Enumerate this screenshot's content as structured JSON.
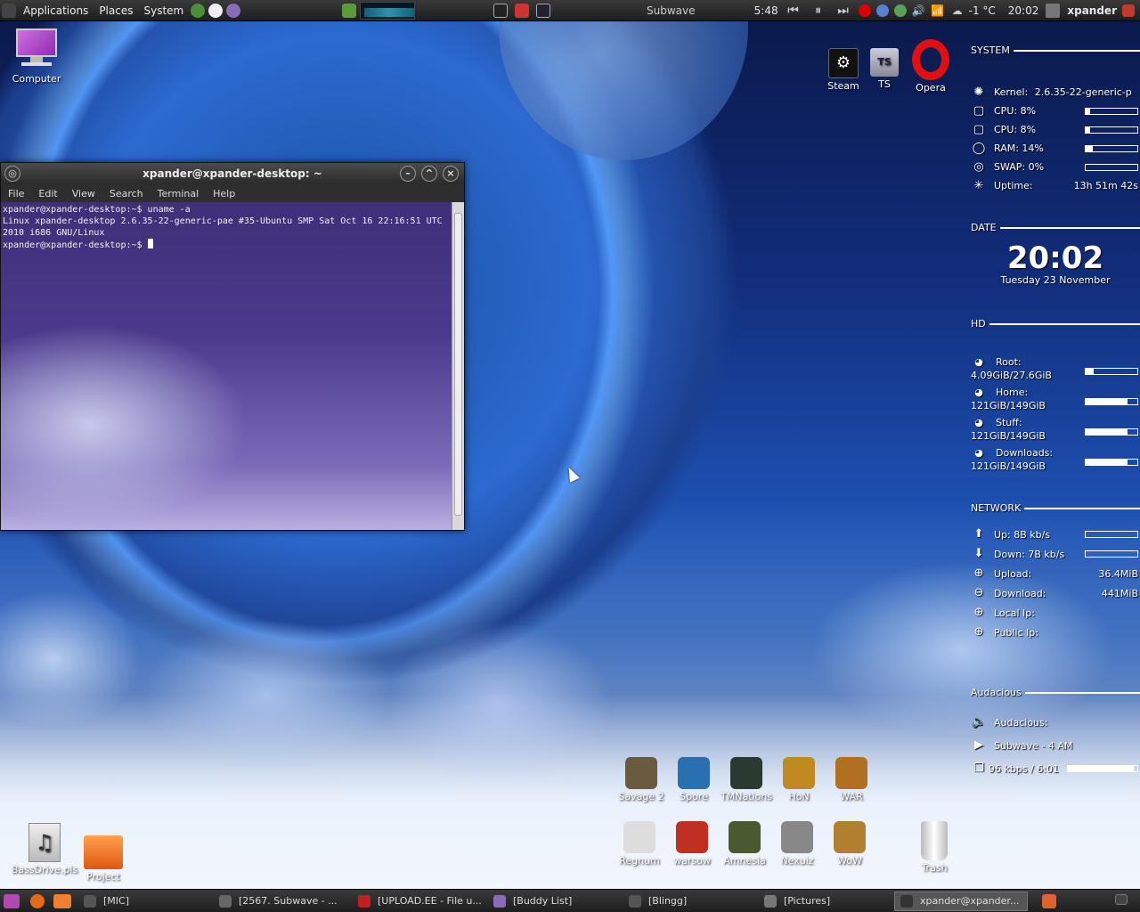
{
  "top_panel": {
    "menus": [
      "Applications",
      "Places",
      "System"
    ],
    "now_playing": "Subwave",
    "time_elapsed": "5:48",
    "weather": "-1 °C",
    "clock": "20:02",
    "user": "xpander"
  },
  "desktop_icons": {
    "computer": "Computer",
    "steam": "Steam",
    "ts": "TS",
    "ts_glyph": "TS",
    "opera": "Opera",
    "bassdrive": "BassDrive.pls",
    "project": "Project",
    "trash": "Trash"
  },
  "terminal": {
    "title": "xpander@xpander-desktop: ~",
    "menu": [
      "File",
      "Edit",
      "View",
      "Search",
      "Terminal",
      "Help"
    ],
    "lines": [
      "xpander@xpander-desktop:~$ uname -a",
      "Linux xpander-desktop 2.6.35-22-generic-pae #35-Ubuntu SMP Sat Oct 16 22:16:51 UTC 2010 i686 GNU/Linux",
      "xpander@xpander-desktop:~$ "
    ]
  },
  "conky": {
    "system_head": "SYSTEM",
    "kernel_label": "Kernel:",
    "kernel": "2.6.35-22-generic-p",
    "cpu1": "CPU: 8%",
    "cpu1_pct": 8,
    "cpu2": "CPU: 8%",
    "cpu2_pct": 8,
    "ram": "RAM: 14%",
    "ram_pct": 14,
    "swap": "SWAP: 0%",
    "swap_pct": 0,
    "uptime_label": "Uptime:",
    "uptime": "13h 51m 42s",
    "date_head": "DATE",
    "time": "20:02",
    "date": "Tuesday 23 November",
    "hd_head": "HD",
    "hd": [
      {
        "label": "Root:",
        "value": "4.09GiB/27.6GiB",
        "pct": 15
      },
      {
        "label": "Home:",
        "value": "121GiB/149GiB",
        "pct": 81
      },
      {
        "label": "Stuff:",
        "value": "121GiB/149GiB",
        "pct": 81
      },
      {
        "label": "Downloads:",
        "value": "121GiB/149GiB",
        "pct": 81
      }
    ],
    "net_head": "NETWORK",
    "up": "Up: 8B  kb/s",
    "down": "Down: 7B  kb/s",
    "upload_label": "Upload:",
    "upload": "36.4MiB",
    "download_label": "Download:",
    "download": "441MiB",
    "local_ip": "Local Ip:",
    "public_ip": "Public Ip:",
    "aud_head": "Audacious",
    "aud_label": "Audacious:",
    "aud_track": "Subwave - 4 AM",
    "aud_bitrate": "96 kbps / 6:01",
    "aud_pct": 95
  },
  "games_row1": [
    "Savage 2",
    "Spore",
    "TMNations",
    "HoN",
    "WAR"
  ],
  "games_row2": [
    "Regnum",
    "warsow",
    "Amnesia",
    "Nexuiz",
    "WoW"
  ],
  "taskbar": [
    "[MIC]",
    "[2567. Subwave - ...",
    "[UPLOAD.EE - File u...",
    "[Buddy List]",
    "[Blingg]",
    "[Pictures]",
    "xpander@xpander..."
  ]
}
